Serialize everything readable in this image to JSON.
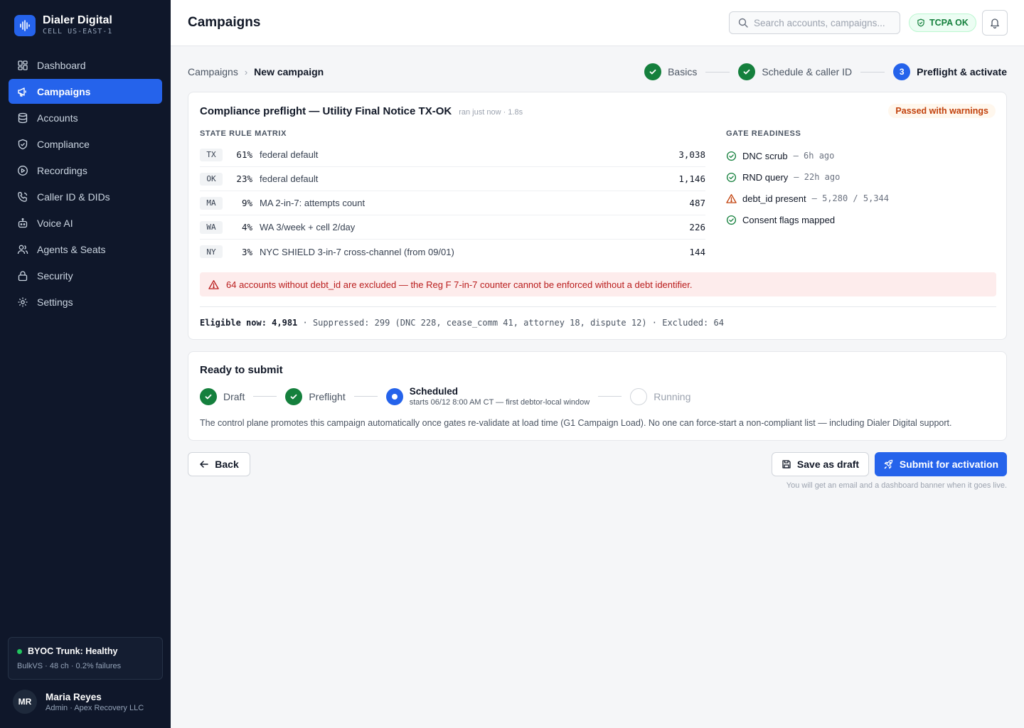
{
  "brand": {
    "name": "Dialer Digital",
    "cell": "CELL US-EAST-1"
  },
  "sidebar": {
    "items": [
      {
        "label": "Dashboard",
        "icon": "grid-icon",
        "active": false
      },
      {
        "label": "Campaigns",
        "icon": "megaphone-icon",
        "active": true
      },
      {
        "label": "Accounts",
        "icon": "database-icon",
        "active": false
      },
      {
        "label": "Compliance",
        "icon": "shield-icon",
        "active": false
      },
      {
        "label": "Recordings",
        "icon": "play-circle-icon",
        "active": false
      },
      {
        "label": "Caller ID & DIDs",
        "icon": "phone-icon",
        "active": false
      },
      {
        "label": "Voice AI",
        "icon": "bot-icon",
        "active": false
      },
      {
        "label": "Agents & Seats",
        "icon": "users-icon",
        "active": false
      },
      {
        "label": "Security",
        "icon": "lock-icon",
        "active": false
      },
      {
        "label": "Settings",
        "icon": "gear-icon",
        "active": false
      }
    ],
    "trunk": {
      "title": "BYOC Trunk: Healthy",
      "detail": "BulkVS · 48 ch · 0.2% failures"
    },
    "user": {
      "initials": "MR",
      "name": "Maria Reyes",
      "role": "Admin · Apex Recovery LLC"
    }
  },
  "header": {
    "title": "Campaigns",
    "search_placeholder": "Search accounts, campaigns...",
    "tcpa_badge": "TCPA OK"
  },
  "breadcrumb": {
    "parent": "Campaigns",
    "separator": "›",
    "current": "New campaign"
  },
  "wizard_steps": [
    {
      "label": "Basics",
      "state": "done"
    },
    {
      "label": "Schedule & caller ID",
      "state": "done"
    },
    {
      "label": "Preflight & activate",
      "state": "current",
      "number": "3"
    }
  ],
  "preflight": {
    "title": "Compliance preflight — Utility Final Notice TX-OK",
    "meta": "ran just now · 1.8s",
    "status_badge": "Passed with warnings",
    "matrix_label": "STATE RULE MATRIX",
    "rows": [
      {
        "state": "TX",
        "pct": "61%",
        "rule": "federal default",
        "count": "3,038"
      },
      {
        "state": "OK",
        "pct": "23%",
        "rule": "federal default",
        "count": "1,146"
      },
      {
        "state": "MA",
        "pct": "9%",
        "rule": "MA 2-in-7: attempts count",
        "count": "487"
      },
      {
        "state": "WA",
        "pct": "4%",
        "rule": "WA 3/week + cell 2/day",
        "count": "226"
      },
      {
        "state": "NY",
        "pct": "3%",
        "rule": "NYC SHIELD 3-in-7 cross-channel (from 09/01)",
        "count": "144"
      }
    ],
    "gates_label": "GATE READINESS",
    "gates": [
      {
        "label": "DNC scrub",
        "meta": "— 6h ago",
        "status": "ok"
      },
      {
        "label": "RND query",
        "meta": "— 22h ago",
        "status": "ok"
      },
      {
        "label": "debt_id present",
        "meta": "— 5,280 / 5,344",
        "status": "warn"
      },
      {
        "label": "Consent flags mapped",
        "meta": "",
        "status": "ok"
      }
    ],
    "alert": "64 accounts without debt_id are excluded — the Reg F 7-in-7 counter cannot be enforced without a debt identifier.",
    "summary_eligible": "Eligible now: 4,981",
    "summary_rest": " · Suppressed: 299 (DNC 228, cease_comm 41, attorney 18, dispute 12) · Excluded: 64"
  },
  "submit_card": {
    "title": "Ready to submit",
    "timeline": [
      {
        "label": "Draft",
        "state": "done"
      },
      {
        "label": "Preflight",
        "state": "done"
      },
      {
        "label": "Scheduled",
        "sub": "starts 06/12 8:00 AM CT — first debtor-local window",
        "state": "current"
      },
      {
        "label": "Running",
        "state": "pending"
      }
    ],
    "note": "The control plane promotes this campaign automatically once gates re-validate at load time (G1 Campaign Load). No one can force-start a non-compliant list — including Dialer Digital support."
  },
  "actions": {
    "back": "Back",
    "save_draft": "Save as draft",
    "submit": "Submit for activation",
    "hint": "You will get an email and a dashboard banner when it goes live."
  },
  "colors": {
    "accent": "#2563eb",
    "success": "#15803d",
    "warning": "#c2410c",
    "danger": "#b91c1c",
    "sidebar_bg": "#0f172a"
  }
}
